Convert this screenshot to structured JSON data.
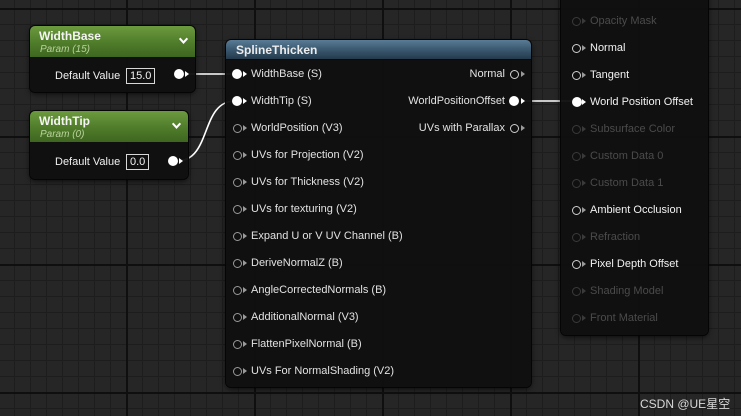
{
  "width_base": {
    "title": "WidthBase",
    "subtitle": "Param (15)",
    "default_label": "Default Value",
    "value": "15.0"
  },
  "width_tip": {
    "title": "WidthTip",
    "subtitle": "Param (0)",
    "default_label": "Default Value",
    "value": "0.0"
  },
  "spline": {
    "title": "SplineThicken",
    "inputs": [
      "WidthBase (S)",
      "WidthTip (S)",
      "WorldPosition (V3)",
      "UVs for Projection (V2)",
      "UVs for Thickness (V2)",
      "UVs for texturing (V2)",
      "Expand U or V UV Channel (B)",
      "DeriveNormalZ (B)",
      "AngleCorrectedNormals (B)",
      "AdditionalNormal (V3)",
      "FlattenPixelNormal (B)",
      "UVs For NormalShading (V2)"
    ],
    "outputs": [
      "Normal",
      "WorldPositionOffset",
      "UVs with Parallax"
    ]
  },
  "material": {
    "pins": [
      {
        "label": "Opacity Mask",
        "enabled": false
      },
      {
        "label": "Normal",
        "enabled": true
      },
      {
        "label": "Tangent",
        "enabled": true
      },
      {
        "label": "World Position Offset",
        "enabled": true
      },
      {
        "label": "Subsurface Color",
        "enabled": false
      },
      {
        "label": "Custom Data 0",
        "enabled": false
      },
      {
        "label": "Custom Data 1",
        "enabled": false
      },
      {
        "label": "Ambient Occlusion",
        "enabled": true
      },
      {
        "label": "Refraction",
        "enabled": false
      },
      {
        "label": "Pixel Depth Offset",
        "enabled": true
      },
      {
        "label": "Shading Model",
        "enabled": false
      },
      {
        "label": "Front Material",
        "enabled": false
      }
    ]
  },
  "watermark": "CSDN @UE星空"
}
